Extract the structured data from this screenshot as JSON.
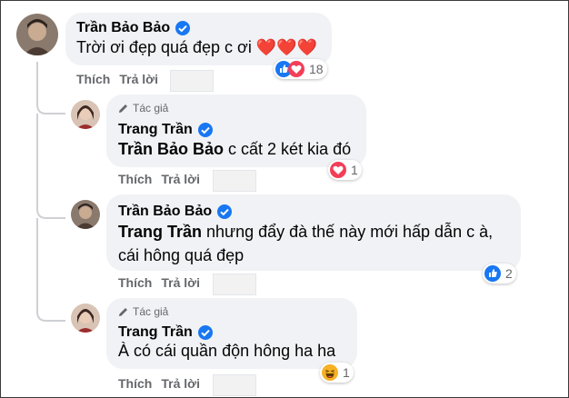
{
  "comments": [
    {
      "author": "Trần Bảo Bảo",
      "text": "Trời ơi đẹp quá đẹp c ơi ❤️❤️❤️",
      "reaction_count": "18",
      "reactions": [
        "like-icon",
        "love-icon"
      ]
    },
    {
      "author_tag": "Tác giả",
      "author": "Trang Trần",
      "mention": "Trần Bảo Bảo",
      "text": " c cất 2 két kia đó",
      "reaction_count": "1",
      "reactions": [
        "love-icon"
      ]
    },
    {
      "author": "Trần Bảo Bảo",
      "mention": "Trang Trần",
      "text_line1": " nhưng đẩy đà thế này mới hấp dẫn c à,",
      "text_line2": "cái hông quá đẹp",
      "reaction_count": "2",
      "reactions": [
        "like-icon"
      ]
    },
    {
      "author_tag": "Tác giả",
      "author": "Trang Trần",
      "text": "À có cái quần độn hông ha ha",
      "reaction_count": "1",
      "reactions": [
        "haha-icon"
      ]
    }
  ],
  "actions": {
    "like": "Thích",
    "reply": "Trả lời"
  },
  "colors": {
    "like_blue": "#1877f2",
    "love_red": "#f33e58",
    "haha_yellow": "#f7b125",
    "bubble": "#f0f2f5",
    "meta_gray": "#65676b"
  }
}
